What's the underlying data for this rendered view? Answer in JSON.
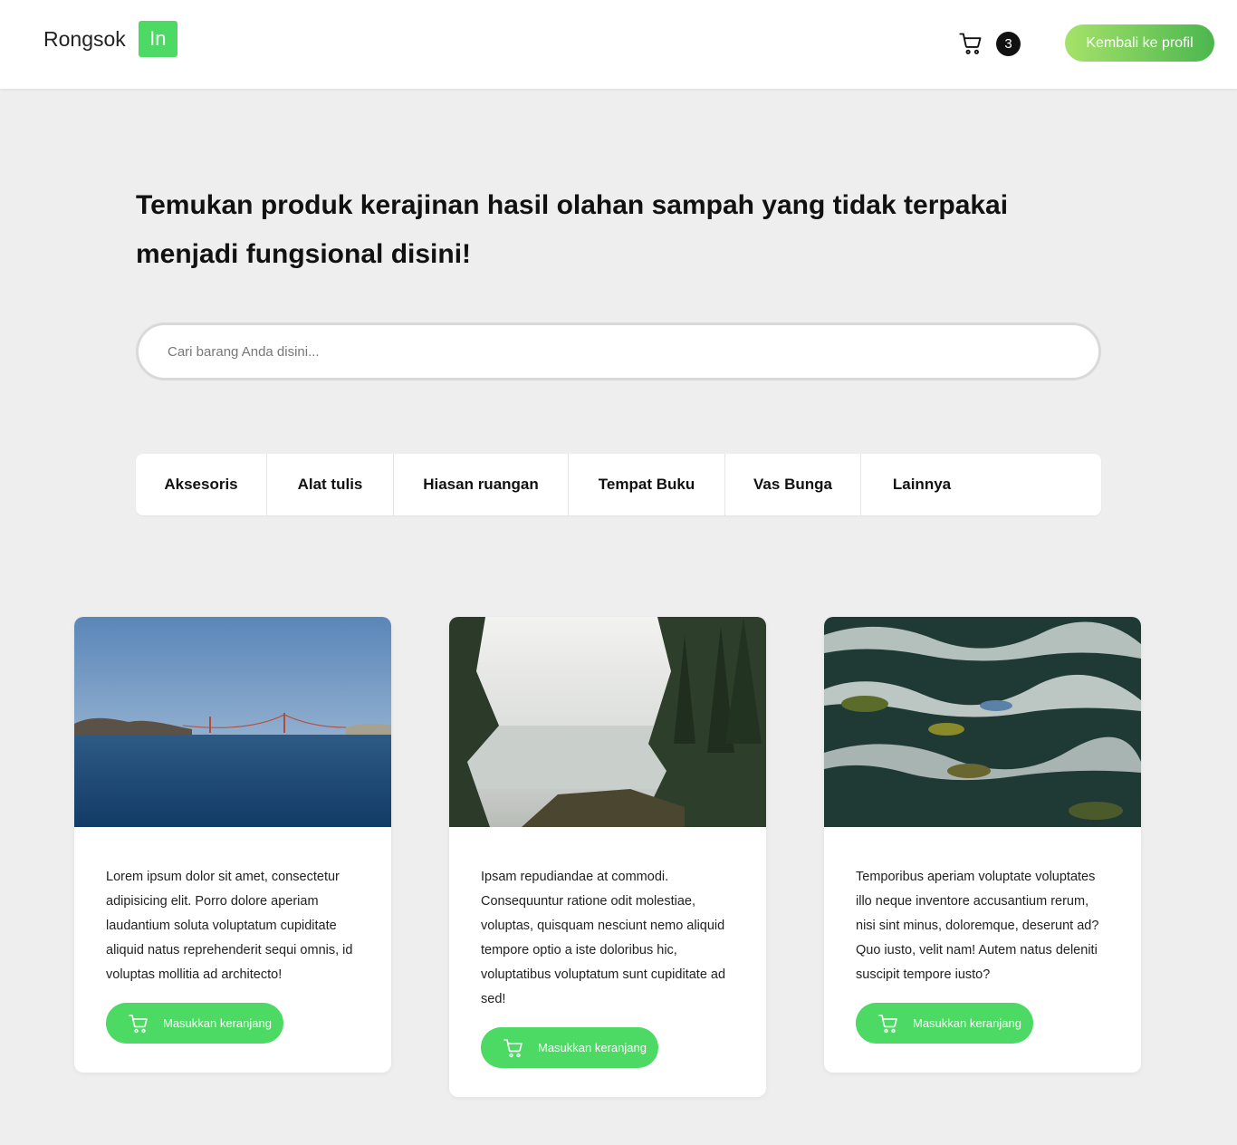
{
  "navbar": {
    "brand_text": "Rongsok",
    "brand_badge": "In",
    "cart_icon": "shopping-cart-icon",
    "cart_count": "3",
    "profile_button": "Kembali ke profil"
  },
  "hero": {
    "title": "Temukan produk kerajinan hasil olahan sampah yang tidak terpakai menjadi fungsional disini!"
  },
  "search": {
    "placeholder": "Cari barang Anda disini..."
  },
  "categories": [
    {
      "label": "Aksesoris"
    },
    {
      "label": "Alat tulis"
    },
    {
      "label": "Hiasan ruangan"
    },
    {
      "label": "Tempat Buku"
    },
    {
      "label": "Vas Bunga"
    },
    {
      "label": "Lainnya"
    }
  ],
  "products": [
    {
      "image": "bay-bridge-landscape",
      "description": "Lorem ipsum dolor sit amet, consectetur adipisicing elit. Porro dolore aperiam laudantium soluta voluptatum cupiditate aliquid natus reprehenderit sequi omnis, id voluptas mollitia ad architecto!",
      "button": "Masukkan keranjang"
    },
    {
      "image": "misty-lake-forest",
      "description": "Ipsam repudiandae at commodi. Consequuntur ratione odit molestiae, voluptas, quisquam nesciunt nemo aliquid tempore optio a iste doloribus hic, voluptatibus voluptatum sunt cupiditate ad sed!",
      "button": "Masukkan keranjang"
    },
    {
      "image": "rushing-river-water",
      "description": "Temporibus aperiam voluptate voluptates illo neque inventore accusantium rerum, nisi sint minus, doloremque, deserunt ad? Quo iusto, velit nam! Autem natus deleniti suscipit tempore iusto?",
      "button": "Masukkan keranjang"
    }
  ],
  "colors": {
    "accent": "#4cd964",
    "background": "#eeeeee",
    "gradient_start": "#a6e26a",
    "gradient_end": "#4bb74e"
  }
}
